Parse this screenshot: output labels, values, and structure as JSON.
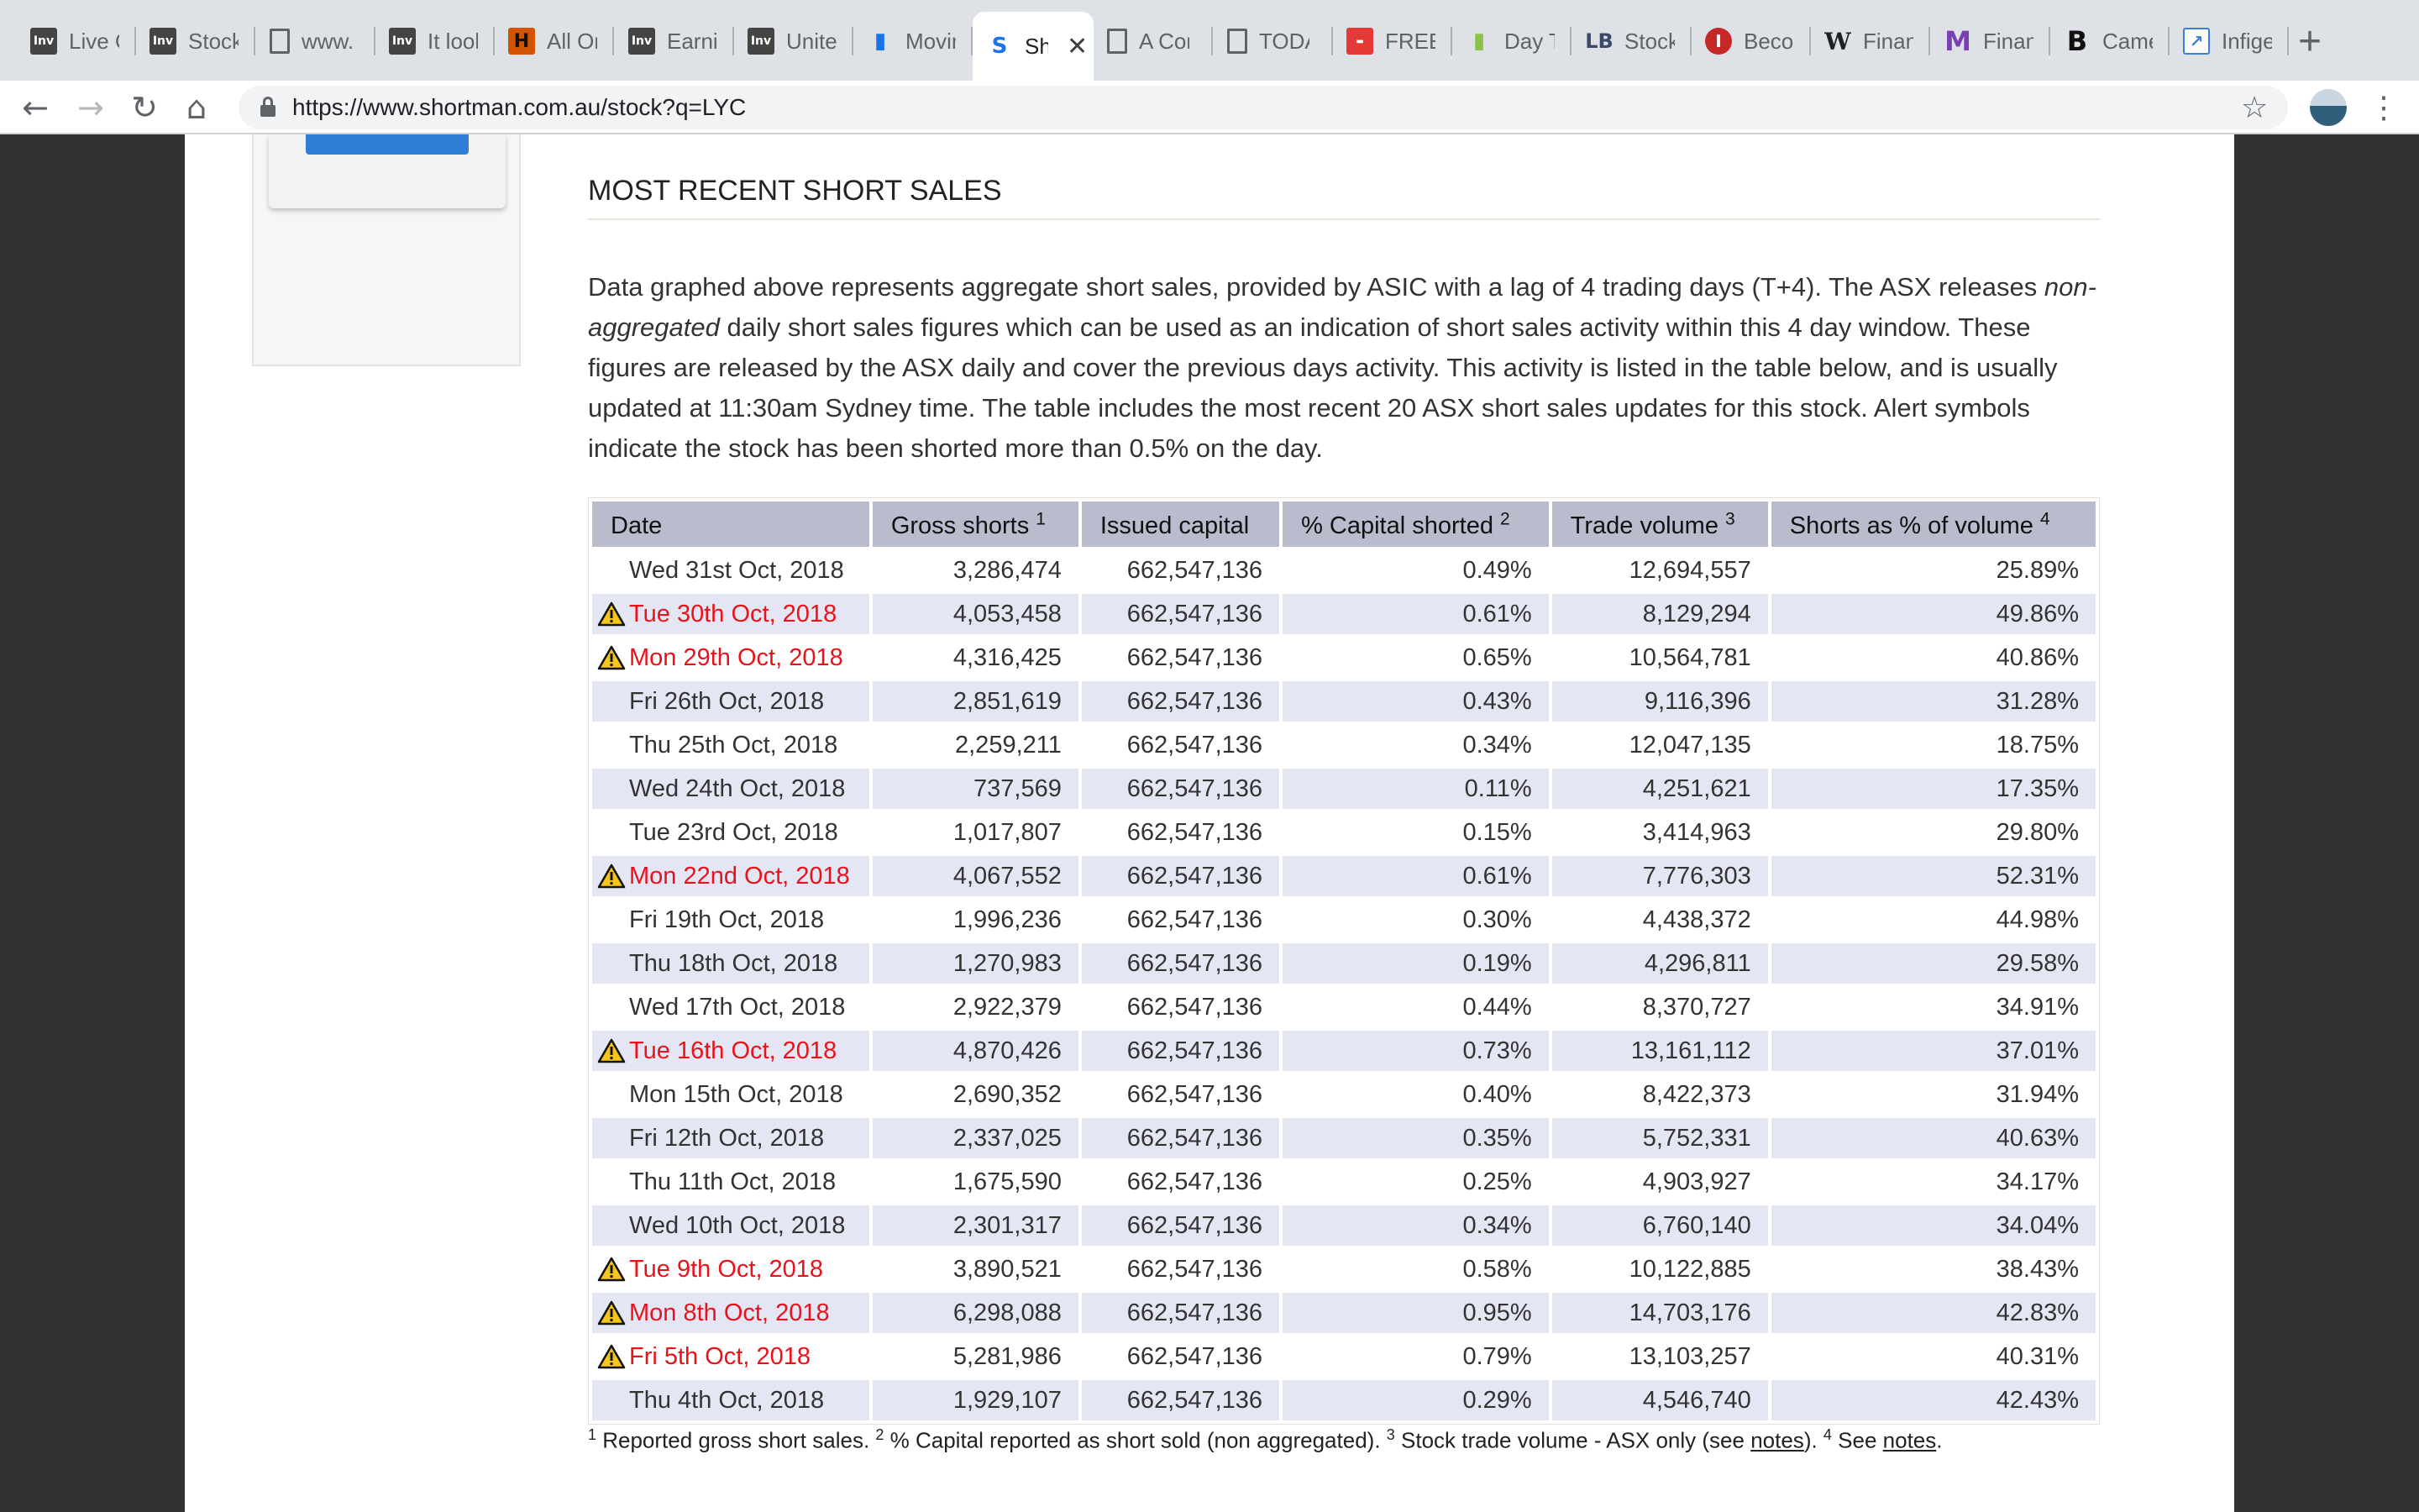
{
  "browser": {
    "tabs": [
      {
        "label": "Live C",
        "icon": "investing-icon",
        "glyph": "Inv"
      },
      {
        "label": "Stock",
        "icon": "investing-icon",
        "glyph": "Inv"
      },
      {
        "label": "www.",
        "icon": "document-icon",
        "glyph": ""
      },
      {
        "label": "It look",
        "icon": "investing-icon",
        "glyph": "Inv"
      },
      {
        "label": "All Or",
        "icon": "history-icon",
        "glyph": "H"
      },
      {
        "label": "Earnin",
        "icon": "investing-icon",
        "glyph": "Inv"
      },
      {
        "label": "Unite",
        "icon": "investing-icon",
        "glyph": "Inv"
      },
      {
        "label": "Movin",
        "icon": "bar-chart-icon",
        "glyph": "▮"
      },
      {
        "label": "Sh",
        "icon": "shortman-icon",
        "glyph": "S",
        "active": true
      },
      {
        "label": "A Cor",
        "icon": "document-icon",
        "glyph": ""
      },
      {
        "label": "TODA",
        "icon": "document-icon",
        "glyph": ""
      },
      {
        "label": "FREE",
        "icon": "free-icon",
        "glyph": "▬"
      },
      {
        "label": "Day T",
        "icon": "candles-icon",
        "glyph": "▮"
      },
      {
        "label": "Stock",
        "icon": "lb-icon",
        "glyph": "LB"
      },
      {
        "label": "Becon",
        "icon": "info-icon",
        "glyph": "I"
      },
      {
        "label": "Finan",
        "icon": "wikipedia-icon",
        "glyph": "W"
      },
      {
        "label": "Finan",
        "icon": "medium-icon",
        "glyph": "M"
      },
      {
        "label": "Came",
        "icon": "bold-b-icon",
        "glyph": "B"
      },
      {
        "label": "Infige",
        "icon": "line-chart-icon",
        "glyph": "↗"
      }
    ],
    "url": "https://www.shortman.com.au/stock?q=LYC"
  },
  "section": {
    "title": "MOST RECENT SHORT SALES",
    "para_1": "Data graphed above represents aggregate short sales, provided by ASIC with a lag of 4 trading days (T+4). The ASX releases ",
    "para_em": "non-aggregated",
    "para_2": " daily short sales figures which can be used as an indication of short sales activity within this 4 day window. These figures are released by the ASX daily and cover the previous days activity. This activity is listed in the table below, and is usually updated at 11:30am Sydney time. The table includes the most recent 20 ASX short sales updates for this stock. Alert symbols indicate the stock has been shorted more than 0.5% on the day."
  },
  "table": {
    "headers": [
      {
        "label": "Date",
        "sup": ""
      },
      {
        "label": "Gross shorts ",
        "sup": "1"
      },
      {
        "label": "Issued capital",
        "sup": ""
      },
      {
        "label": "% Capital shorted ",
        "sup": "2"
      },
      {
        "label": "Trade volume ",
        "sup": "3"
      },
      {
        "label": "Shorts as % of volume ",
        "sup": "4"
      }
    ],
    "rows": [
      {
        "date": "Wed 31st Oct, 2018",
        "alert": false,
        "gross": "3,286,474",
        "issued": "662,547,136",
        "pct_capital": "0.49%",
        "volume": "12,694,557",
        "pct_volume": "25.89%"
      },
      {
        "date": "Tue 30th Oct, 2018",
        "alert": true,
        "gross": "4,053,458",
        "issued": "662,547,136",
        "pct_capital": "0.61%",
        "volume": "8,129,294",
        "pct_volume": "49.86%"
      },
      {
        "date": "Mon 29th Oct, 2018",
        "alert": true,
        "gross": "4,316,425",
        "issued": "662,547,136",
        "pct_capital": "0.65%",
        "volume": "10,564,781",
        "pct_volume": "40.86%"
      },
      {
        "date": "Fri 26th Oct, 2018",
        "alert": false,
        "gross": "2,851,619",
        "issued": "662,547,136",
        "pct_capital": "0.43%",
        "volume": "9,116,396",
        "pct_volume": "31.28%"
      },
      {
        "date": "Thu 25th Oct, 2018",
        "alert": false,
        "gross": "2,259,211",
        "issued": "662,547,136",
        "pct_capital": "0.34%",
        "volume": "12,047,135",
        "pct_volume": "18.75%"
      },
      {
        "date": "Wed 24th Oct, 2018",
        "alert": false,
        "gross": "737,569",
        "issued": "662,547,136",
        "pct_capital": "0.11%",
        "volume": "4,251,621",
        "pct_volume": "17.35%"
      },
      {
        "date": "Tue 23rd Oct, 2018",
        "alert": false,
        "gross": "1,017,807",
        "issued": "662,547,136",
        "pct_capital": "0.15%",
        "volume": "3,414,963",
        "pct_volume": "29.80%"
      },
      {
        "date": "Mon 22nd Oct, 2018",
        "alert": true,
        "gross": "4,067,552",
        "issued": "662,547,136",
        "pct_capital": "0.61%",
        "volume": "7,776,303",
        "pct_volume": "52.31%"
      },
      {
        "date": "Fri 19th Oct, 2018",
        "alert": false,
        "gross": "1,996,236",
        "issued": "662,547,136",
        "pct_capital": "0.30%",
        "volume": "4,438,372",
        "pct_volume": "44.98%"
      },
      {
        "date": "Thu 18th Oct, 2018",
        "alert": false,
        "gross": "1,270,983",
        "issued": "662,547,136",
        "pct_capital": "0.19%",
        "volume": "4,296,811",
        "pct_volume": "29.58%"
      },
      {
        "date": "Wed 17th Oct, 2018",
        "alert": false,
        "gross": "2,922,379",
        "issued": "662,547,136",
        "pct_capital": "0.44%",
        "volume": "8,370,727",
        "pct_volume": "34.91%"
      },
      {
        "date": "Tue 16th Oct, 2018",
        "alert": true,
        "gross": "4,870,426",
        "issued": "662,547,136",
        "pct_capital": "0.73%",
        "volume": "13,161,112",
        "pct_volume": "37.01%"
      },
      {
        "date": "Mon 15th Oct, 2018",
        "alert": false,
        "gross": "2,690,352",
        "issued": "662,547,136",
        "pct_capital": "0.40%",
        "volume": "8,422,373",
        "pct_volume": "31.94%"
      },
      {
        "date": "Fri 12th Oct, 2018",
        "alert": false,
        "gross": "2,337,025",
        "issued": "662,547,136",
        "pct_capital": "0.35%",
        "volume": "5,752,331",
        "pct_volume": "40.63%"
      },
      {
        "date": "Thu 11th Oct, 2018",
        "alert": false,
        "gross": "1,675,590",
        "issued": "662,547,136",
        "pct_capital": "0.25%",
        "volume": "4,903,927",
        "pct_volume": "34.17%"
      },
      {
        "date": "Wed 10th Oct, 2018",
        "alert": false,
        "gross": "2,301,317",
        "issued": "662,547,136",
        "pct_capital": "0.34%",
        "volume": "6,760,140",
        "pct_volume": "34.04%"
      },
      {
        "date": "Tue 9th Oct, 2018",
        "alert": true,
        "gross": "3,890,521",
        "issued": "662,547,136",
        "pct_capital": "0.58%",
        "volume": "10,122,885",
        "pct_volume": "38.43%"
      },
      {
        "date": "Mon 8th Oct, 2018",
        "alert": true,
        "gross": "6,298,088",
        "issued": "662,547,136",
        "pct_capital": "0.95%",
        "volume": "14,703,176",
        "pct_volume": "42.83%"
      },
      {
        "date": "Fri 5th Oct, 2018",
        "alert": true,
        "gross": "5,281,986",
        "issued": "662,547,136",
        "pct_capital": "0.79%",
        "volume": "13,103,257",
        "pct_volume": "40.31%"
      },
      {
        "date": "Thu 4th Oct, 2018",
        "alert": false,
        "gross": "1,929,107",
        "issued": "662,547,136",
        "pct_capital": "0.29%",
        "volume": "4,546,740",
        "pct_volume": "42.43%"
      }
    ]
  },
  "footnotes": {
    "sup1": "1",
    "text1": " Reported gross short sales. ",
    "sup2": "2",
    "text2": " % Capital reported as short sold (non aggregated). ",
    "sup3": "3",
    "text3": " Stock trade volume - ASX only (see ",
    "link3": "notes",
    "text3b": "). ",
    "sup4": "4",
    "text4": " See ",
    "link4": "notes",
    "text4b": "."
  },
  "colors": {
    "alert_text": "#e8131a",
    "header_bg": "#b9bccc",
    "stripe_bg": "#e4e6f3",
    "page_side_bg": "#323232"
  }
}
